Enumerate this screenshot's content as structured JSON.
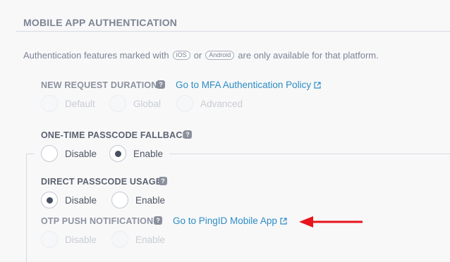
{
  "section": {
    "title": "MOBILE APP AUTHENTICATION"
  },
  "note": {
    "prefix": "Authentication features marked with",
    "ios_badge": "iOS",
    "or_text": "or",
    "android_badge": "Android",
    "suffix": "are only available for that platform."
  },
  "new_request_duration": {
    "label": "NEW REQUEST DURATION",
    "help": "?",
    "link": "Go to MFA Authentication Policy",
    "link_icon": "external-link-icon",
    "options": [
      "Default",
      "Global",
      "Advanced"
    ],
    "selected": null,
    "disabled": true
  },
  "otp_fallback": {
    "label": "ONE-TIME PASSCODE FALLBACK",
    "help": "?",
    "options": [
      "Disable",
      "Enable"
    ],
    "selected": "Enable",
    "disabled": false
  },
  "direct_passcode": {
    "label": "DIRECT PASSCODE USAGE",
    "help": "?",
    "options": [
      "Disable",
      "Enable"
    ],
    "selected": "Disable",
    "disabled": false
  },
  "otp_push": {
    "label": "OTP PUSH NOTIFICATION",
    "help": "?",
    "link": "Go to PingID Mobile App",
    "link_icon": "external-link-icon",
    "options": [
      "Disable",
      "Enable"
    ],
    "selected": null,
    "disabled": true
  },
  "annotation": {
    "arrow_color": "#e8141b",
    "icon": "arrow-left-icon"
  },
  "colors": {
    "link": "#2d8cc4",
    "accent_dot": "#475062",
    "background": "#f8f8f9"
  }
}
